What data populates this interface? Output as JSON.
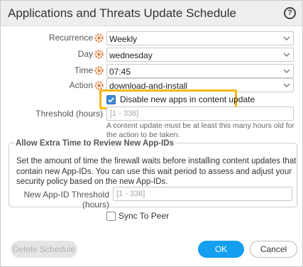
{
  "dialog": {
    "title": "Applications and Threats Update Schedule",
    "help_icon": "question-circle-icon"
  },
  "form": {
    "recurrence": {
      "label": "Recurrence",
      "value": "Weekly"
    },
    "day": {
      "label": "Day",
      "value": "wednesday"
    },
    "time": {
      "label": "Time",
      "value": "07:45"
    },
    "action": {
      "label": "Action",
      "value": "download-and-install"
    },
    "disable_new_apps": {
      "label": "Disable new apps in content update",
      "checked": true
    },
    "threshold": {
      "label": "Threshold (hours)",
      "placeholder": "[1 - 336]",
      "help": "A content update must be at least this many hours old for the action to be taken."
    }
  },
  "extra_time": {
    "legend": "Allow Extra Time to Review New App-IDs",
    "description": "Set the amount of time the firewall waits before installing content updates that contain new App-IDs. You can use this wait period to assess and adjust your security policy based on the new App-IDs.",
    "threshold_label": "New App-ID Threshold (hours)",
    "threshold_placeholder": "[1 - 336]"
  },
  "sync": {
    "label": "Sync To Peer",
    "checked": false
  },
  "buttons": {
    "delete": "Delete Schedule",
    "ok": "OK",
    "cancel": "Cancel"
  },
  "colors": {
    "accent": "#159ff1",
    "highlight": "#f3b811",
    "checkbox": "#3b8bd6",
    "gear": "#e07b39"
  },
  "icons": {
    "field_icon": "gear-icon",
    "dropdown": "chevron-down-icon"
  }
}
